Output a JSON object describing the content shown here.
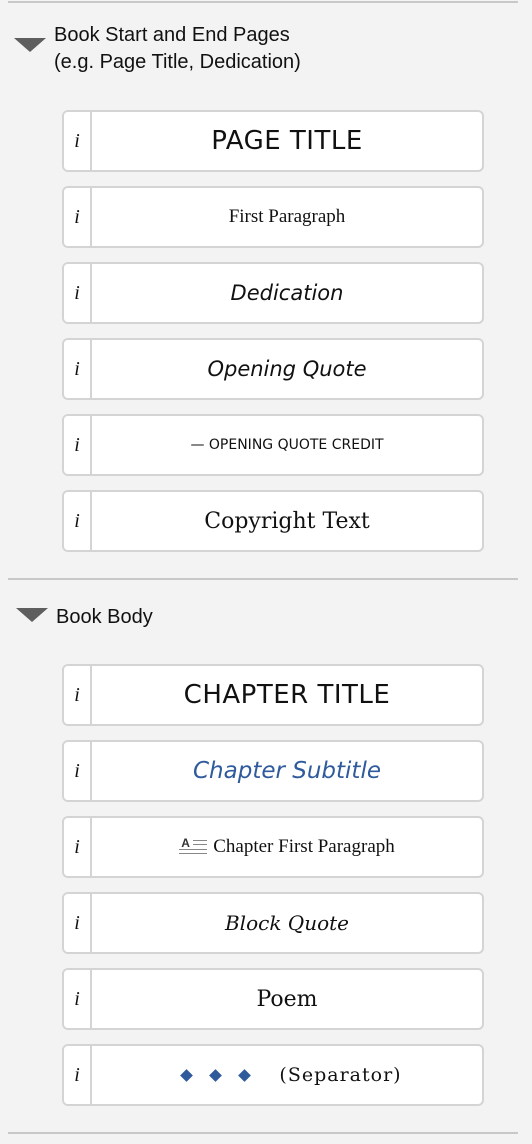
{
  "sections": [
    {
      "title_line1": "Book Start and End Pages",
      "title_line2": "(e.g. Page Title, Dedication)",
      "info_label": "i",
      "items": [
        {
          "label": "PAGE TITLE"
        },
        {
          "label": "First Paragraph"
        },
        {
          "label": "Dedication"
        },
        {
          "label": "Opening Quote"
        },
        {
          "label": "— OPENING QUOTE CREDIT"
        },
        {
          "label": "Copyright Text"
        }
      ]
    },
    {
      "title_line1": "Book Body",
      "info_label": "i",
      "items": [
        {
          "label": "CHAPTER TITLE"
        },
        {
          "label": "Chapter Subtitle"
        },
        {
          "label": "Chapter First Paragraph",
          "icon_letter": "A"
        },
        {
          "label": "Block Quote"
        },
        {
          "label": "Poem"
        },
        {
          "label": "(Separator)"
        }
      ]
    }
  ],
  "colors": {
    "subtitle_blue": "#2f5a9c",
    "separator_diamond": "#2f5a9c",
    "triangle": "#5e5e5e"
  }
}
